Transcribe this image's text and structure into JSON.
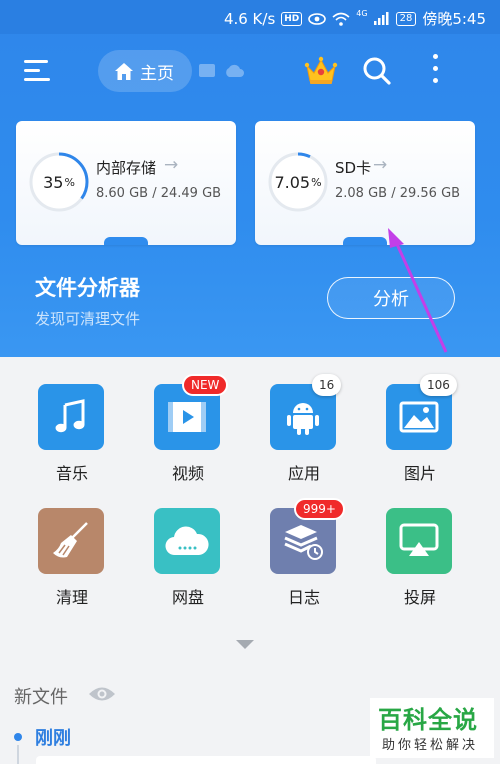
{
  "status_bar": {
    "speed": "4.6 K/s",
    "hd": "HD",
    "network": "4G",
    "battery": "28",
    "time": "傍晚5:45"
  },
  "toolbar": {
    "home_label": "主页"
  },
  "storage": [
    {
      "title": "内部存储",
      "percent": "35",
      "percent_unit": "%",
      "percent_value": 0.35,
      "size": "8.60 GB / 24.49 GB"
    },
    {
      "title": "SD卡",
      "percent": "7.05",
      "percent_unit": "%",
      "percent_value": 0.0705,
      "size": "2.08 GB / 29.56 GB"
    }
  ],
  "analyzer": {
    "title": "文件分析器",
    "subtitle": "发现可清理文件",
    "button": "分析"
  },
  "grid": [
    {
      "label": "音乐",
      "icon": "music-icon",
      "color": "#2a94e8",
      "badge": ""
    },
    {
      "label": "视频",
      "icon": "video-icon",
      "color": "#2a94e8",
      "badge": "NEW"
    },
    {
      "label": "应用",
      "icon": "android-icon",
      "color": "#2a94e8",
      "badge": "16"
    },
    {
      "label": "图片",
      "icon": "image-icon",
      "color": "#2a94e8",
      "badge": "106"
    },
    {
      "label": "清理",
      "icon": "broom-icon",
      "color": "#b8876a",
      "badge": ""
    },
    {
      "label": "网盘",
      "icon": "cloud-icon",
      "color": "#39c0c4",
      "badge": ""
    },
    {
      "label": "日志",
      "icon": "log-icon",
      "color": "#6f7fae",
      "badge": "999+"
    },
    {
      "label": "投屏",
      "icon": "cast-icon",
      "color": "#3bbf87",
      "badge": ""
    }
  ],
  "recent": {
    "title": "新文件",
    "group": "刚刚"
  },
  "watermark": {
    "main": "百科全说",
    "sub": "助你轻松解决"
  },
  "colors": {
    "primary": "#2f86ea",
    "badge_red": "#f02a2a",
    "annotation_arrow": "#c33fe8"
  }
}
